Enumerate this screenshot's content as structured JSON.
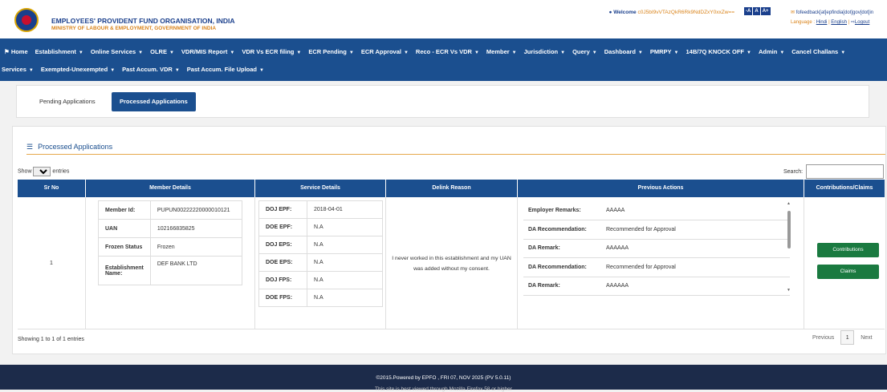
{
  "header": {
    "org_name": "EMPLOYEES' PROVIDENT FUND ORGANISATION, INDIA",
    "ministry": "MINISTRY OF LABOUR & EMPLOYMENT, GOVERNMENT OF INDIA",
    "welcome_label": "Welcome",
    "welcome_token": "c0J5bI9vVTAzQkR6Rk9NdDZxY0xxZw==",
    "font_buttons": [
      "-A",
      "A",
      "A+"
    ],
    "feedback_email": "fofeedback[at]epfindia[dot]gov[dot]in",
    "language_label": "Language :",
    "lang_hindi": "Hindi",
    "lang_sep": "|",
    "lang_english": "English",
    "logout": "Logout"
  },
  "nav": {
    "row1": [
      "Home",
      "Establishment",
      "Online Services",
      "OLRE",
      "VDR/MIS Report",
      "VDR Vs ECR filing",
      "ECR Pending",
      "ECR Approval",
      "Reco - ECR Vs VDR",
      "Member",
      "Jurisdiction",
      "Query",
      "Dashboard",
      "PMRPY",
      "14B/7Q KNOCK OFF",
      "Admin",
      "Cancel Challans"
    ],
    "row2": [
      "Services",
      "Exempted-Unexempted",
      "Past Accum. VDR",
      "Past Accum. File Upload"
    ]
  },
  "tabs": {
    "pending": "Pending Applications",
    "processed": "Processed Applications"
  },
  "panel": {
    "title": "Processed Applications",
    "show_label": "Show",
    "entries_label": "entries",
    "page_size": "10",
    "search_label": "Search:",
    "columns": [
      "Sr No",
      "Member Details",
      "Service Details",
      "Delink Reason",
      "Previous Actions",
      "Contributions/Claims"
    ]
  },
  "row": {
    "sr": "1",
    "member": [
      {
        "k": "Member Id:",
        "v": "PUPUN00222220000010121"
      },
      {
        "k": "UAN",
        "v": "102166835825"
      },
      {
        "k": "Frozen Status",
        "v": "Frozen"
      },
      {
        "k": "Establishment Name:",
        "v": "DEF BANK LTD"
      }
    ],
    "service": [
      {
        "k": "DOJ EPF:",
        "v": "2018-04-01"
      },
      {
        "k": "DOE EPF:",
        "v": "N.A"
      },
      {
        "k": "DOJ EPS:",
        "v": "N.A"
      },
      {
        "k": "DOE EPS:",
        "v": "N.A"
      },
      {
        "k": "DOJ FPS:",
        "v": "N.A"
      },
      {
        "k": "DOE FPS:",
        "v": "N.A"
      }
    ],
    "delink_reason": "I never worked in this establishment and my UAN was added without my consent.",
    "previous_actions": [
      {
        "k": "Employer Remarks:",
        "v": "AAAAA"
      },
      {
        "k": "DA Recommendation:",
        "v": "Recommended for Approval"
      },
      {
        "k": "DA Remark:",
        "v": "AAAAAA"
      },
      {
        "k": "DA Recommendation:",
        "v": "Recommended for Approval"
      },
      {
        "k": "DA Remark:",
        "v": "AAAAAA"
      }
    ],
    "contributions_btn": "Contributions",
    "claims_btn": "Claims"
  },
  "table_footer": {
    "showing": "Showing 1 to 1 of 1 entries",
    "previous": "Previous",
    "page": "1",
    "next": "Next"
  },
  "footer": {
    "line1": "©2015.Powered by EPFO , FRI 07, NOV 2025 (PV 5.0.11)",
    "line2": "This site is best viewed through Mozilla Firefox 58 or higher"
  },
  "colors": {
    "brand": "#1b4f8f",
    "accent": "#e6a94c",
    "button_green": "#1a7a40"
  }
}
